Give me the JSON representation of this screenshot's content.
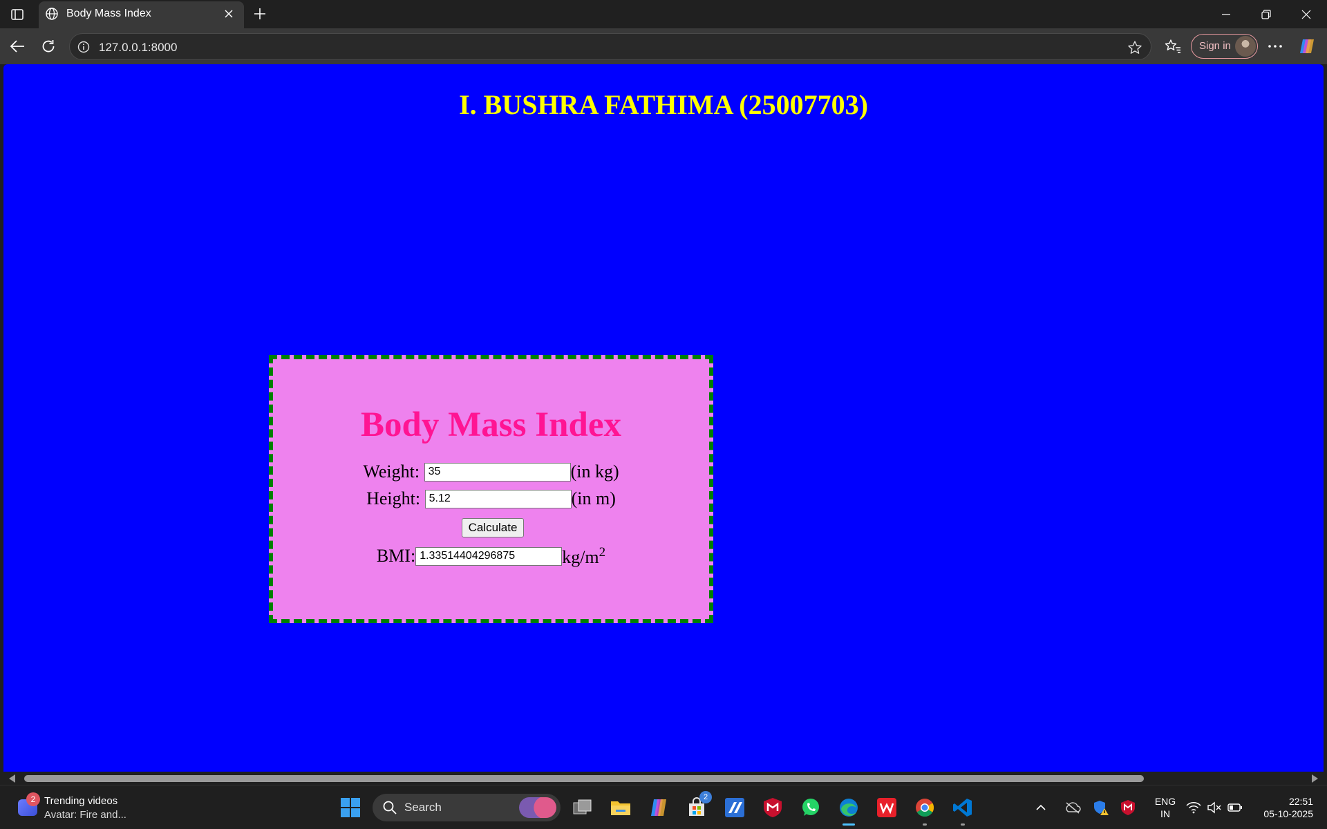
{
  "browser": {
    "tab_title": "Body Mass Index",
    "url": "127.0.0.1:8000",
    "sign_in_label": "Sign in"
  },
  "page": {
    "author_heading": "I. BUSHRA FATHIMA (25007703)",
    "bmi_title": "Body Mass Index",
    "weight_label": "Weight:",
    "weight_value": "35",
    "weight_unit": "(in kg)",
    "height_label": "Height:",
    "height_value": "5.12",
    "height_unit": "(in m)",
    "calculate_label": "Calculate",
    "bmi_label": "BMI:",
    "bmi_value": "1.33514404296875",
    "bmi_unit": "kg/m",
    "bmi_unit_exponent": "2",
    "colors": {
      "background": "#0000ff",
      "heading": "#ffff00",
      "box": "#ee82ee",
      "box_border": "#008000",
      "title": "#ff1493"
    }
  },
  "taskbar": {
    "widget_badge": "2",
    "widget_title": "Trending videos",
    "widget_subtitle": "Avatar: Fire and...",
    "search_label": "Search",
    "store_badge": "2",
    "lang_line1": "ENG",
    "lang_line2": "IN",
    "time": "22:51",
    "date": "05-10-2025",
    "icons": [
      "start-icon",
      "task-view-icon",
      "file-explorer-icon",
      "copilot-icon",
      "microsoft-store-icon",
      "app-icon",
      "mcafee-icon",
      "whatsapp-icon",
      "edge-icon",
      "wps-office-icon",
      "chrome-icon",
      "vscode-icon"
    ]
  }
}
